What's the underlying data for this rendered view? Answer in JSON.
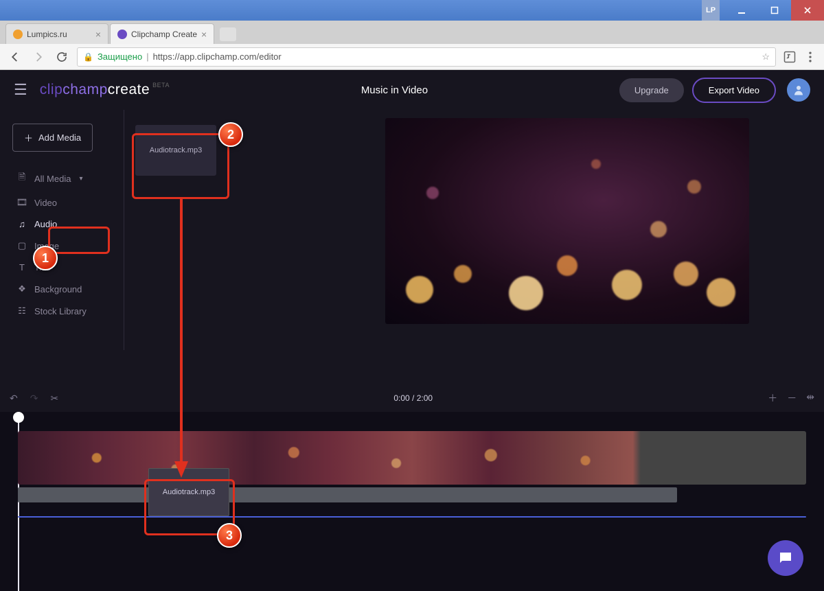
{
  "window": {
    "user_badge": "LP"
  },
  "tabs": [
    {
      "title": "Lumpics.ru",
      "favicon_color": "#f0a030"
    },
    {
      "title": "Clipchamp Create",
      "favicon_color": "#6a4bc3"
    }
  ],
  "address_bar": {
    "secure_label": "Защищено",
    "url_prefix": "https://",
    "url_host": "app.clipchamp.com",
    "url_path": "/editor"
  },
  "app": {
    "logo": {
      "part1": "clip",
      "part2": "champ",
      "part3": "create",
      "beta": "BETA"
    },
    "project_title": "Music in Video",
    "upgrade_label": "Upgrade",
    "export_label": "Export Video",
    "add_media_label": "Add Media",
    "sidebar": {
      "items": [
        {
          "label": "All Media",
          "icon": "file"
        },
        {
          "label": "Video",
          "icon": "film"
        },
        {
          "label": "Audio",
          "icon": "music"
        },
        {
          "label": "Image",
          "icon": "image"
        },
        {
          "label": "Title",
          "icon": "title"
        },
        {
          "label": "Background",
          "icon": "layers"
        },
        {
          "label": "Stock Library",
          "icon": "library"
        }
      ]
    },
    "media_card_label": "Audiotrack.mp3",
    "playback": {
      "current": "0:00",
      "total": "2:00"
    },
    "timeline_audio_clip_label": "Audiotrack.mp3"
  },
  "annotations": {
    "badge1": "1",
    "badge2": "2",
    "badge3": "3"
  }
}
